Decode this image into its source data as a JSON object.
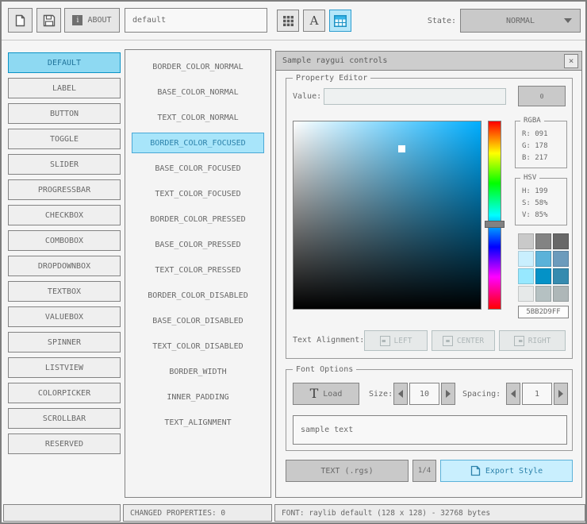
{
  "toolbar": {
    "about_label": "ABOUT",
    "style_name_value": "default",
    "state_label": "State:",
    "state_value": "NORMAL"
  },
  "icons": {
    "close_glyph": "×",
    "info_glyph": "i",
    "font_glyph": "A",
    "load_glyph": "T"
  },
  "controls": {
    "selected": "DEFAULT",
    "items": [
      "DEFAULT",
      "LABEL",
      "BUTTON",
      "TOGGLE",
      "SLIDER",
      "PROGRESSBAR",
      "CHECKBOX",
      "COMBOBOX",
      "DROPDOWNBOX",
      "TEXTBOX",
      "VALUEBOX",
      "SPINNER",
      "LISTVIEW",
      "COLORPICKER",
      "SCROLLBAR",
      "RESERVED"
    ]
  },
  "properties": {
    "selected": "BORDER_COLOR_FOCUSED",
    "items": [
      "BORDER_COLOR_NORMAL",
      "BASE_COLOR_NORMAL",
      "TEXT_COLOR_NORMAL",
      "BORDER_COLOR_FOCUSED",
      "BASE_COLOR_FOCUSED",
      "TEXT_COLOR_FOCUSED",
      "BORDER_COLOR_PRESSED",
      "BASE_COLOR_PRESSED",
      "TEXT_COLOR_PRESSED",
      "BORDER_COLOR_DISABLED",
      "BASE_COLOR_DISABLED",
      "TEXT_COLOR_DISABLED",
      "BORDER_WIDTH",
      "INNER_PADDING",
      "TEXT_ALIGNMENT"
    ]
  },
  "sample_window": {
    "title": "Sample raygui controls",
    "property_editor": {
      "group_title": "Property Editor",
      "value_label": "Value:",
      "value_text": "",
      "value_button_label": "0",
      "rgba": {
        "title": "RGBA",
        "r_label": "R: 091",
        "g_label": "G: 178",
        "b_label": "B: 217"
      },
      "hsv": {
        "title": "HSV",
        "h_label": "H: 199",
        "s_label": "S: 58%",
        "v_label": "V: 85%"
      },
      "hex_value": "5BB2D9FF",
      "text_alignment_label": "Text Alignment:",
      "align_left_label": "LEFT",
      "align_center_label": "CENTER",
      "align_right_label": "RIGHT"
    },
    "color_picker": {
      "hue": 199,
      "saturation_pct": 58,
      "value_pct": 85,
      "selected_hex": "#5bb2d9",
      "full_sat_color": "#00aeff"
    },
    "palette": {
      "rows": [
        [
          "#c9c9c9",
          "#838383",
          "#686868"
        ],
        [
          "#c9effe",
          "#5bb2d9",
          "#6c9bbc"
        ],
        [
          "#97e8ff",
          "#0492c7",
          "#368baf"
        ],
        [
          "#e6e9e9",
          "#b5c1c2",
          "#aeb7b8"
        ]
      ]
    },
    "font_options": {
      "group_title": "Font Options",
      "load_label": "Load",
      "size_label": "Size:",
      "size_value": "10",
      "spacing_label": "Spacing:",
      "spacing_value": "1",
      "sample_text": "sample text"
    },
    "footer": {
      "export_format_label": "TEXT (.rgs)",
      "page_label": "1/4",
      "export_label": "Export Style"
    }
  },
  "statusbar": {
    "left_text": "",
    "changed_properties": "CHANGED PROPERTIES: 0",
    "font_info": "FONT: raylib default (128 x 128) - 32768 bytes"
  }
}
